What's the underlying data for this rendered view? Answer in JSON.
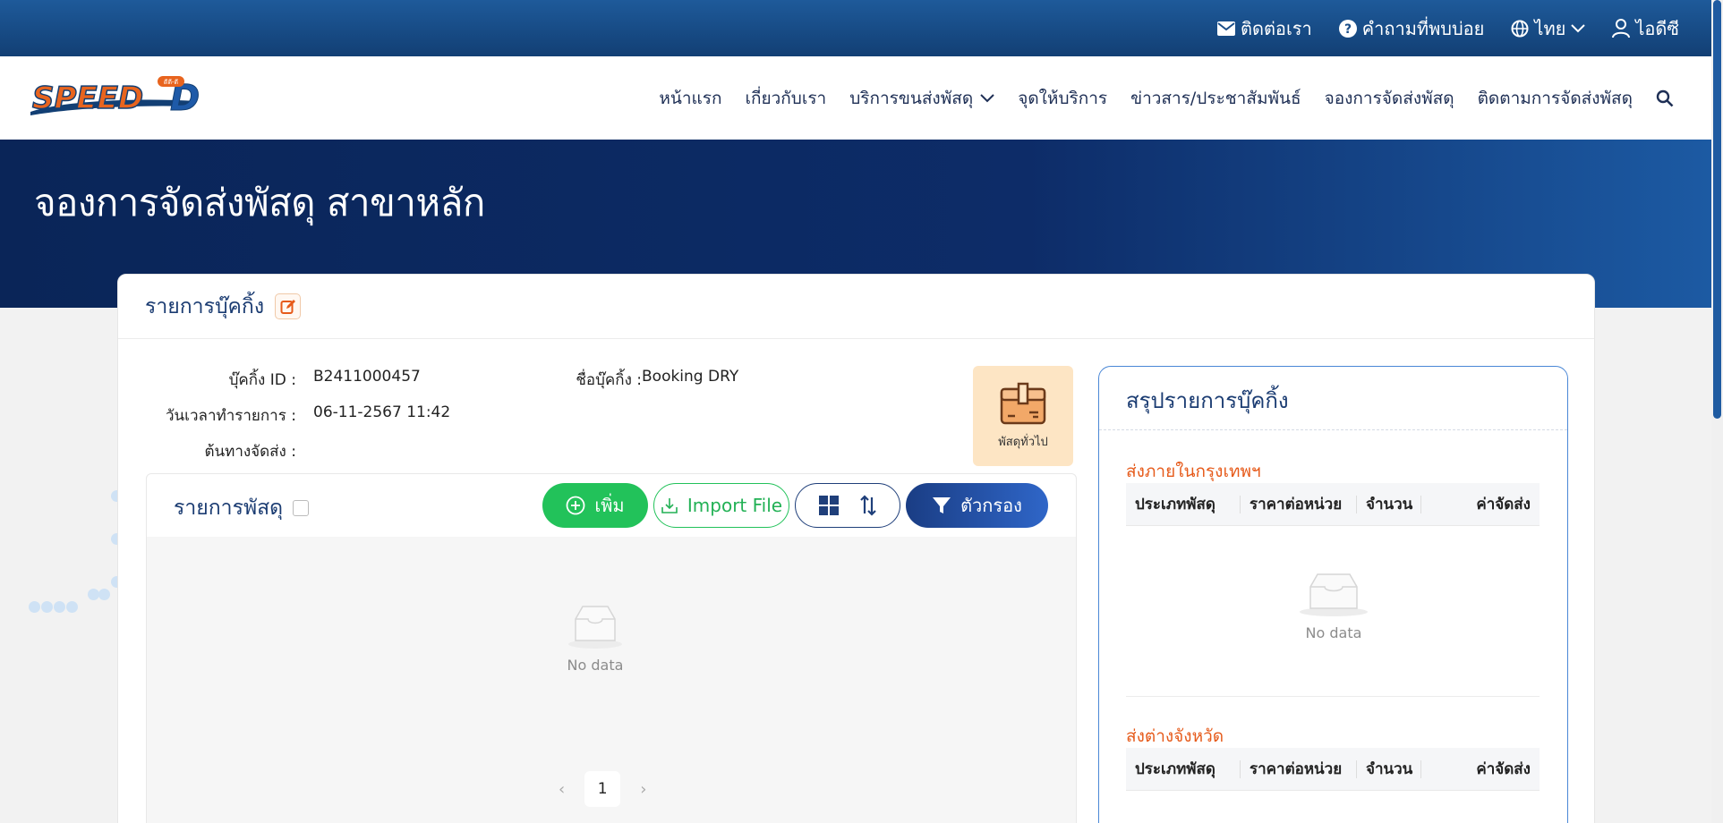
{
  "topbar": {
    "contact": "ติดต่อเรา",
    "faq": "คำถามที่พบบ่อย",
    "language": "ไทย",
    "user": "ไอดีซี"
  },
  "logo": {
    "text": "SPEED D",
    "small_text": "ดีดี-ดี"
  },
  "nav": {
    "items": [
      "หน้าแรก",
      "เกี่ยวกับเรา",
      "บริการขนส่งพัสดุ",
      "จุดให้บริการ",
      "ข่าวสาร/ประชาสัมพันธ์",
      "จองการจัดส่งพัสดุ",
      "ติดตามการจัดส่งพัสดุ"
    ]
  },
  "hero": {
    "title": "จองการจัดส่งพัสดุ สาขาหลัก"
  },
  "booking": {
    "title": "รายการบุ๊คกิ้ง",
    "id_label": "บุ๊คกิ้ง ID :",
    "id_value": "B2411000457",
    "name_label": "ชื่อบุ๊คกิ้ง :",
    "name_value": "Booking DRY",
    "datetime_label": "วันเวลาทำรายการ :",
    "datetime_value": "06-11-2567 11:42",
    "origin_label": "ต้นทางจัดส่ง :",
    "origin_value": "",
    "parcel_type_label": "พัสดุทั่วไป"
  },
  "parcel_list": {
    "title": "รายการพัสดุ",
    "add_label": "เพิ่ม",
    "import_label": "Import File",
    "filter_label": "ตัวกรอง",
    "empty_text": "No data",
    "page": "1"
  },
  "summary": {
    "title": "สรุปรายการบุ๊คกิ้ง",
    "bangkok_title": "ส่งภายในกรุงเทพฯ",
    "province_title": "ส่งต่างจังหวัด",
    "columns": [
      "ประเภทพัสดุ",
      "ราคาต่อหน่วย",
      "จำนวน",
      "ค่าจัดส่ง"
    ],
    "empty_text": "No data"
  },
  "colors": {
    "primary": "#1b3c72",
    "accent_orange": "#e65a1a",
    "add_green": "#22c25a",
    "hero_dark": "#0a2558"
  }
}
